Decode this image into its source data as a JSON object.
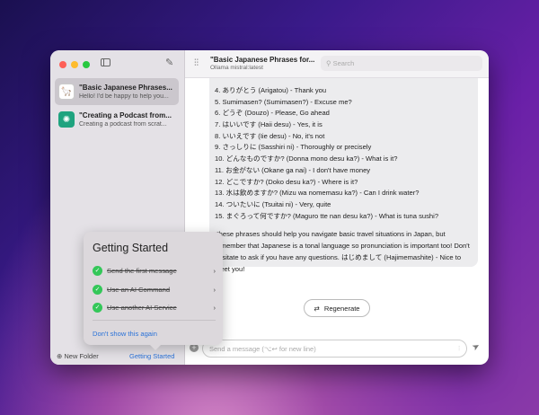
{
  "sidebar": {
    "chats": [
      {
        "title": "\"Basic Japanese Phrases...",
        "preview": "Hello! I'd be happy to help you...",
        "selected": true
      },
      {
        "title": "\"Creating a Podcast from...",
        "preview": "Creating a podcast from scrat..."
      }
    ],
    "new_folder": "New Folder",
    "getting_started": "Getting Started"
  },
  "header": {
    "title": "\"Basic Japanese Phrases for...",
    "model": "Ollama mistral:latest",
    "search_placeholder": "Search"
  },
  "message": {
    "lines": [
      "4.  ありがとう (Arigatou) - Thank you",
      "5.  Sumimasen? (Sumimasen?) - Excuse me?",
      "6.  どうぞ (Douzo) - Please, Go ahead",
      "7.  はいいです (Haii desu) - Yes, it is",
      "8.  いいえです (Iie desu) - No, it's not",
      "9.  さっしりに (Sasshiri ni) - Thoroughly or precisely",
      "10.  どんなものですか?  (Donna mono desu ka?) - What is it?",
      "11.  お金がない (Okane ga nai) - I don't have money",
      "12.  どこですか?  (Doko desu ka?) - Where is it?",
      "13.  水は飲めますか?  (Mizu wa nomemasu ka?) - Can I drink water?",
      "14.  ついたいに (Tsuitai ni) - Very, quite",
      "15.  まぐろって何ですか?  (Maguro tte nan desu ka?) - What is tuna sushi?"
    ],
    "paragraph": "These phrases should help you navigate basic travel situations in Japan, but remember that Japanese is a tonal language so pronunciation is important too! Don't hesitate to ask if you have any questions. はじめまして (Hajimemashite) - Nice to meet you!"
  },
  "regenerate": "Regenerate",
  "input_placeholder": "Send a message (⌥↩ for new line)",
  "popover": {
    "title": "Getting Started",
    "items": [
      "Send the first message",
      "Use an AI Command",
      "Use another AI Service"
    ],
    "dismiss": "Don't show this again"
  }
}
